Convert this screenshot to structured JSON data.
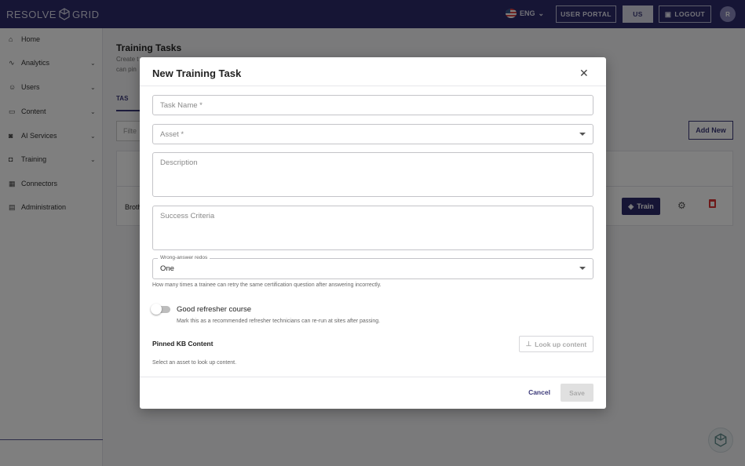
{
  "header": {
    "logo_text": "RESOLVE",
    "logo_text2": "GRID",
    "language": "ENG",
    "user_portal_label": "USER PORTAL",
    "region_label": "US",
    "logout_label": "LOGOUT",
    "avatar_initial": "R"
  },
  "sidebar": {
    "items": [
      {
        "label": "Home",
        "icon": "home-icon"
      },
      {
        "label": "Analytics",
        "icon": "chart-icon"
      },
      {
        "label": "Users",
        "icon": "users-icon"
      },
      {
        "label": "Content",
        "icon": "folder-icon"
      },
      {
        "label": "AI Services",
        "icon": "ai-icon"
      },
      {
        "label": "Training",
        "icon": "training-icon"
      },
      {
        "label": "Connectors",
        "icon": "grid-icon"
      },
      {
        "label": "Administration",
        "icon": "building-icon"
      }
    ]
  },
  "page": {
    "title": "Training Tasks",
    "desc1": "Create t",
    "desc2": "can pin",
    "tab_label": "TAS",
    "filter_placeholder": "Filte",
    "add_new_label": "Add New",
    "row_name": "Broth",
    "train_label": "Train"
  },
  "modal": {
    "title": "New Training Task",
    "task_name_label": "Task Name *",
    "asset_label": "Asset *",
    "description_label": "Description",
    "success_label": "Success Criteria",
    "redos_legend": "Wrong-answer redos",
    "redos_value": "One",
    "redos_help": "How many times a trainee can retry the same certification question after answering incorrectly.",
    "toggle_label": "Good refresher course",
    "toggle_help": "Mark this as a recommended refresher technicians can re-run at sites after passing.",
    "pinned_title": "Pinned KB Content",
    "lookup_label": "Look up content",
    "pinned_help": "Select an asset to look up content.",
    "cancel_label": "Cancel",
    "save_label": "Save"
  },
  "colors": {
    "brand": "#2c2a6b",
    "danger": "#d33333"
  }
}
